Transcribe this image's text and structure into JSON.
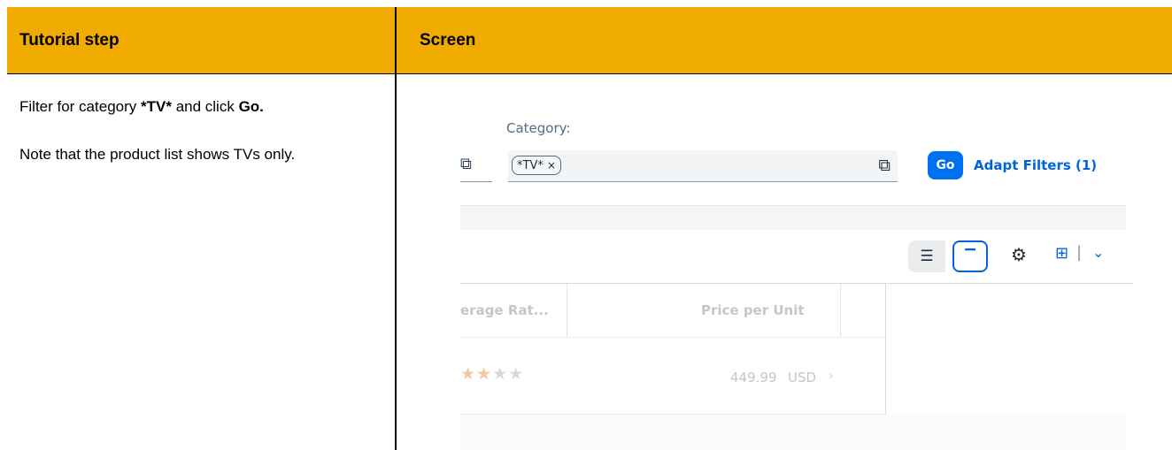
{
  "table": {
    "header_left": "Tutorial step",
    "header_right": "Screen",
    "header_color": "#f0ab00"
  },
  "step": {
    "line1_prefix": "Filter for category ",
    "line1_bold1": "*TV*",
    "line1_mid": " and click ",
    "line1_bold2": "Go.",
    "line2": "Note that the product list shows TVs only."
  },
  "screen": {
    "category_label": "Category:",
    "token_text": "*TV*",
    "token_remove": "×",
    "go_label": "Go",
    "adapt_filters_label": "Adapt Filters (1)",
    "accent_color": "#0070f2",
    "icons": [
      "value-help-icon",
      "clear-token-icon",
      "condensed-view-icon",
      "standard-view-icon",
      "settings-gear-icon",
      "export-icon",
      "chevron-down-icon",
      "row-navigation-icon"
    ],
    "columns": {
      "average_rating": "erage Rat...",
      "price_per_unit": "Price per Unit"
    },
    "row": {
      "rating_stars": 2,
      "rating_max": 5,
      "price": "449.99",
      "currency": "USD"
    }
  }
}
